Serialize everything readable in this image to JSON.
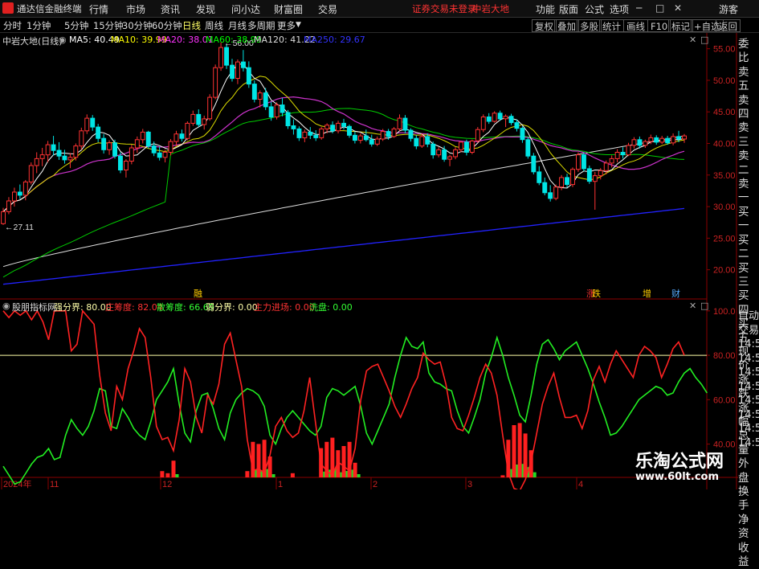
{
  "app": {
    "title": "通达信金融终端",
    "menu": [
      "行情",
      "市场",
      "资讯",
      "发现",
      "问小达",
      "财富圈",
      "交易"
    ],
    "login_notice": "证券交易未登录",
    "stock_name_top": "中岩大地",
    "right_menu": [
      "功能",
      "版面",
      "公式",
      "选项"
    ],
    "guest": "游客"
  },
  "timeframes": [
    "分时",
    "1分钟",
    "5分钟",
    "15分钟",
    "30分钟",
    "60分钟",
    "日线",
    "周线",
    "月线",
    "多周期",
    "更多"
  ],
  "active_timeframe": "日线",
  "toolbar_right": [
    "复权",
    "叠加",
    "多股",
    "统计",
    "画线",
    "F10",
    "标记",
    "+自选",
    "返回"
  ],
  "main_info": {
    "title": "中岩大地(日线)",
    "ma": [
      {
        "label": "MA5: 40.49",
        "color": "#ffffff"
      },
      {
        "label": "MA10: 39.99",
        "color": "#ffff00"
      },
      {
        "label": "MA20: 38.01",
        "color": "#ff33ff"
      },
      {
        "label": "MA60: 38.99",
        "color": "#00ff00"
      },
      {
        "label": "MA120: 41.22",
        "color": "#dddddd"
      },
      {
        "label": "MA250: 29.67",
        "color": "#3333ff"
      }
    ]
  },
  "price_axis": [
    "55.00",
    "50.00",
    "45.00",
    "40.00",
    "35.00",
    "30.00",
    "25.00",
    "20.00"
  ],
  "annotations": {
    "high": "56.00",
    "low": "27.11"
  },
  "markers": [
    {
      "text": "融",
      "color": "#ffcc00"
    },
    {
      "text": "涨",
      "color": "#ff3333"
    },
    {
      "text": "跌",
      "color": "#ffcc00"
    },
    {
      "text": "增",
      "color": "#ffcc00"
    },
    {
      "text": "财",
      "color": "#55aaff"
    }
  ],
  "indicator": {
    "name": "股朋指标网",
    "fields": [
      {
        "label": "强分界: 80.00",
        "color": "#ffffaa"
      },
      {
        "label": "庄筹度: 82.04",
        "color": "#ff3333"
      },
      {
        "label": "散筹度: 66.69",
        "color": "#33ff33"
      },
      {
        "label": "弱分界: 0.00",
        "color": "#ffffaa"
      },
      {
        "label": "主力进场: 0.00",
        "color": "#ff3333"
      },
      {
        "label": "洗盘: 0.00",
        "color": "#33ff33"
      }
    ],
    "axis": [
      "100.0",
      "80.00",
      "60.00",
      "40.00"
    ]
  },
  "date_axis": [
    "2024年",
    "11",
    "12",
    "1",
    "2",
    "3",
    "4"
  ],
  "side_panel": [
    "委比",
    "卖五",
    "卖四",
    "卖三",
    "卖二",
    "卖一",
    "买一",
    "买二",
    "买三",
    "买四",
    "买五",
    "现价",
    "涨跌",
    "涨幅",
    "总量",
    "外盘",
    "换手",
    "净资",
    "收益"
  ],
  "side_panel_lower": [
    "自动",
    "交易",
    "14:56",
    "14:56",
    "14:56",
    "14:56",
    "14:56",
    "14:56",
    "14:56",
    "14:56"
  ],
  "watermark": {
    "name": "乐淘公式网",
    "url": "www.60lt.com"
  },
  "chart_data": {
    "type": "candlestick",
    "y_range": [
      15.5,
      57.5
    ],
    "indicator_range": [
      25,
      105
    ],
    "ohlc": [
      [
        27.3,
        29.8,
        27.1,
        29.2
      ],
      [
        29.2,
        31.5,
        28.8,
        30.9
      ],
      [
        30.9,
        33.0,
        30.0,
        32.3
      ],
      [
        32.3,
        33.5,
        31.2,
        31.8
      ],
      [
        31.8,
        34.2,
        31.0,
        33.9
      ],
      [
        33.9,
        37.0,
        33.5,
        36.5
      ],
      [
        36.5,
        38.6,
        35.3,
        37.6
      ],
      [
        37.6,
        39.3,
        36.4,
        38.2
      ],
      [
        38.2,
        40.4,
        37.0,
        39.8
      ],
      [
        39.8,
        41.2,
        38.1,
        38.9
      ],
      [
        38.9,
        40.2,
        37.4,
        38.0
      ],
      [
        38.0,
        39.0,
        36.8,
        37.4
      ],
      [
        37.4,
        38.5,
        36.1,
        37.8
      ],
      [
        37.8,
        40.0,
        37.3,
        39.6
      ],
      [
        39.6,
        42.5,
        39.0,
        42.0
      ],
      [
        42.0,
        44.6,
        41.5,
        44.0
      ],
      [
        44.0,
        44.5,
        42.0,
        42.6
      ],
      [
        42.6,
        43.1,
        40.2,
        40.8
      ],
      [
        40.8,
        41.5,
        38.4,
        39.0
      ],
      [
        39.0,
        40.5,
        38.2,
        40.1
      ],
      [
        40.1,
        40.6,
        37.6,
        38.0
      ],
      [
        38.0,
        38.6,
        35.3,
        35.8
      ],
      [
        35.8,
        37.5,
        34.6,
        37.2
      ],
      [
        37.2,
        39.8,
        36.7,
        39.3
      ],
      [
        39.3,
        41.1,
        38.5,
        40.6
      ],
      [
        40.6,
        42.3,
        40.0,
        41.8
      ],
      [
        41.8,
        42.0,
        39.2,
        39.6
      ],
      [
        39.6,
        40.3,
        38.0,
        38.5
      ],
      [
        38.5,
        39.5,
        37.3,
        37.8
      ],
      [
        37.8,
        39.0,
        37.0,
        38.6
      ],
      [
        38.6,
        40.7,
        38.1,
        40.3
      ],
      [
        40.3,
        42.0,
        39.6,
        41.5
      ],
      [
        41.5,
        42.2,
        40.3,
        40.8
      ],
      [
        40.8,
        43.5,
        40.5,
        43.2
      ],
      [
        43.2,
        45.2,
        42.8,
        44.6
      ],
      [
        44.6,
        45.4,
        42.6,
        43.0
      ],
      [
        43.0,
        44.4,
        42.2,
        43.9
      ],
      [
        43.9,
        47.8,
        43.6,
        47.3
      ],
      [
        47.3,
        52.5,
        47.0,
        52.0
      ],
      [
        52.0,
        56.0,
        51.5,
        55.2
      ],
      [
        55.2,
        55.8,
        51.8,
        52.4
      ],
      [
        52.4,
        53.4,
        49.8,
        50.3
      ],
      [
        50.3,
        53.3,
        49.4,
        52.9
      ],
      [
        52.9,
        54.8,
        51.4,
        52.0
      ],
      [
        52.0,
        53.0,
        48.8,
        49.4
      ],
      [
        49.4,
        50.0,
        46.5,
        47.0
      ],
      [
        47.0,
        48.4,
        45.7,
        48.0
      ],
      [
        48.0,
        48.8,
        45.3,
        45.8
      ],
      [
        45.8,
        46.6,
        43.6,
        44.2
      ],
      [
        44.2,
        46.5,
        43.8,
        46.1
      ],
      [
        46.1,
        47.2,
        44.3,
        44.9
      ],
      [
        44.9,
        45.3,
        42.3,
        42.8
      ],
      [
        42.8,
        43.8,
        41.4,
        42.3
      ],
      [
        42.3,
        42.7,
        40.4,
        40.9
      ],
      [
        40.9,
        42.2,
        40.2,
        41.8
      ],
      [
        41.8,
        42.6,
        40.7,
        41.3
      ],
      [
        41.3,
        42.1,
        40.4,
        40.9
      ],
      [
        40.9,
        42.6,
        40.6,
        42.3
      ],
      [
        42.3,
        43.2,
        41.6,
        42.9
      ],
      [
        42.9,
        43.5,
        41.6,
        42.0
      ],
      [
        42.0,
        43.6,
        41.6,
        43.2
      ],
      [
        43.2,
        43.9,
        42.2,
        42.7
      ],
      [
        42.7,
        43.0,
        40.9,
        41.3
      ],
      [
        41.3,
        41.9,
        40.0,
        40.5
      ],
      [
        40.5,
        41.6,
        40.0,
        41.2
      ],
      [
        41.2,
        42.2,
        40.3,
        40.6
      ],
      [
        40.6,
        41.4,
        39.5,
        39.9
      ],
      [
        39.9,
        41.1,
        39.6,
        40.7
      ],
      [
        40.7,
        42.3,
        40.4,
        41.9
      ],
      [
        41.9,
        42.3,
        40.6,
        41.1
      ],
      [
        41.1,
        42.6,
        40.9,
        42.3
      ],
      [
        42.3,
        44.6,
        42.0,
        44.0
      ],
      [
        44.0,
        44.5,
        41.6,
        42.1
      ],
      [
        42.1,
        42.4,
        40.3,
        40.8
      ],
      [
        40.8,
        41.3,
        39.1,
        39.6
      ],
      [
        39.6,
        41.6,
        39.3,
        41.1
      ],
      [
        41.1,
        41.6,
        39.4,
        39.9
      ],
      [
        39.9,
        40.3,
        37.6,
        38.2
      ],
      [
        38.2,
        39.4,
        37.8,
        39.0
      ],
      [
        39.0,
        39.6,
        37.1,
        37.5
      ],
      [
        37.5,
        38.2,
        36.4,
        37.9
      ],
      [
        37.9,
        39.4,
        37.5,
        39.0
      ],
      [
        39.0,
        40.4,
        38.6,
        40.2
      ],
      [
        40.2,
        40.6,
        38.1,
        38.6
      ],
      [
        38.6,
        40.6,
        38.3,
        40.4
      ],
      [
        40.4,
        42.6,
        40.1,
        42.2
      ],
      [
        42.2,
        44.6,
        41.8,
        44.2
      ],
      [
        44.2,
        44.8,
        43.1,
        43.5
      ],
      [
        43.5,
        45.1,
        43.3,
        44.8
      ],
      [
        44.8,
        45.2,
        43.6,
        43.9
      ],
      [
        43.9,
        44.6,
        42.6,
        44.3
      ],
      [
        44.3,
        44.7,
        42.9,
        43.3
      ],
      [
        43.3,
        43.8,
        41.9,
        42.4
      ],
      [
        42.4,
        42.7,
        40.1,
        40.6
      ],
      [
        40.6,
        41.0,
        37.6,
        38.0
      ],
      [
        38.0,
        38.5,
        35.1,
        35.5
      ],
      [
        35.5,
        36.4,
        33.4,
        33.8
      ],
      [
        33.8,
        34.6,
        31.8,
        32.2
      ],
      [
        32.2,
        33.4,
        30.8,
        31.3
      ],
      [
        31.3,
        33.5,
        31.0,
        33.1
      ],
      [
        33.1,
        35.0,
        32.6,
        34.6
      ],
      [
        34.6,
        35.2,
        33.0,
        33.5
      ],
      [
        33.5,
        36.2,
        33.1,
        35.9
      ],
      [
        35.9,
        38.6,
        35.5,
        38.2
      ],
      [
        38.2,
        38.6,
        35.6,
        36.0
      ],
      [
        36.0,
        36.5,
        33.6,
        34.0
      ],
      [
        34.0,
        35.5,
        29.5,
        34.9
      ],
      [
        34.9,
        36.1,
        34.3,
        35.7
      ],
      [
        35.7,
        37.3,
        35.1,
        36.9
      ],
      [
        36.9,
        38.1,
        36.2,
        37.6
      ],
      [
        37.6,
        39.1,
        37.0,
        38.6
      ],
      [
        38.6,
        39.4,
        37.6,
        38.2
      ],
      [
        38.2,
        40.1,
        38.0,
        39.7
      ],
      [
        39.7,
        41.0,
        39.2,
        40.6
      ],
      [
        40.6,
        41.1,
        39.2,
        39.7
      ],
      [
        39.7,
        40.6,
        39.3,
        40.3
      ],
      [
        40.3,
        41.4,
        39.9,
        40.9
      ],
      [
        40.9,
        41.3,
        39.8,
        40.2
      ],
      [
        40.2,
        41.2,
        39.9,
        40.8
      ],
      [
        40.8,
        41.2,
        39.8,
        40.1
      ],
      [
        40.1,
        41.6,
        39.7,
        41.1
      ],
      [
        41.1,
        42.0,
        40.2,
        40.7
      ],
      [
        40.7,
        41.5,
        40.1,
        41.2
      ]
    ],
    "ind_red": [
      100,
      97,
      100,
      98,
      100,
      96,
      100,
      95,
      87,
      100,
      100,
      100,
      82,
      85,
      100,
      97,
      94,
      71,
      54,
      46,
      66,
      60,
      74,
      82,
      92,
      88,
      70,
      48,
      42,
      43,
      37,
      51,
      74,
      68,
      52,
      45,
      62,
      58,
      67,
      85,
      90,
      78,
      66,
      42,
      28,
      29,
      27,
      35,
      48,
      52,
      46,
      43,
      45,
      55,
      70,
      50,
      31,
      28,
      26,
      32,
      30,
      28,
      38,
      60,
      73,
      75,
      76,
      70,
      64,
      57,
      52,
      58,
      65,
      70,
      81,
      78,
      76,
      77,
      67,
      52,
      47,
      46,
      53,
      61,
      70,
      76,
      72,
      62,
      44,
      27,
      20,
      19,
      24,
      32,
      45,
      58,
      66,
      72,
      61,
      52,
      52,
      53,
      47,
      55,
      69,
      75,
      68,
      76,
      82,
      78,
      74,
      70,
      80,
      84,
      82,
      79,
      70,
      76,
      83,
      86,
      80
    ],
    "ind_green": [
      30,
      26,
      22,
      23,
      27,
      31,
      34,
      35,
      38,
      33,
      34,
      44,
      51,
      47,
      44,
      48,
      55,
      65,
      64,
      48,
      47,
      56,
      52,
      47,
      44,
      42,
      50,
      60,
      64,
      68,
      74,
      58,
      45,
      41,
      55,
      62,
      63,
      56,
      47,
      42,
      54,
      60,
      63,
      65,
      64,
      62,
      57,
      44,
      40,
      47,
      52,
      55,
      52,
      49,
      46,
      44,
      48,
      61,
      65,
      64,
      62,
      64,
      66,
      57,
      45,
      40,
      46,
      52,
      58,
      70,
      80,
      88,
      84,
      83,
      86,
      72,
      68,
      67,
      65,
      64,
      55,
      48,
      45,
      52,
      60,
      72,
      79,
      88,
      80,
      70,
      62,
      53,
      50,
      62,
      76,
      85,
      87,
      83,
      78,
      82,
      84,
      86,
      80,
      74,
      67,
      59,
      52,
      44,
      45,
      48,
      52,
      56,
      60,
      62,
      64,
      66,
      65,
      62,
      63,
      68,
      72,
      74,
      70,
      67,
      63
    ]
  }
}
